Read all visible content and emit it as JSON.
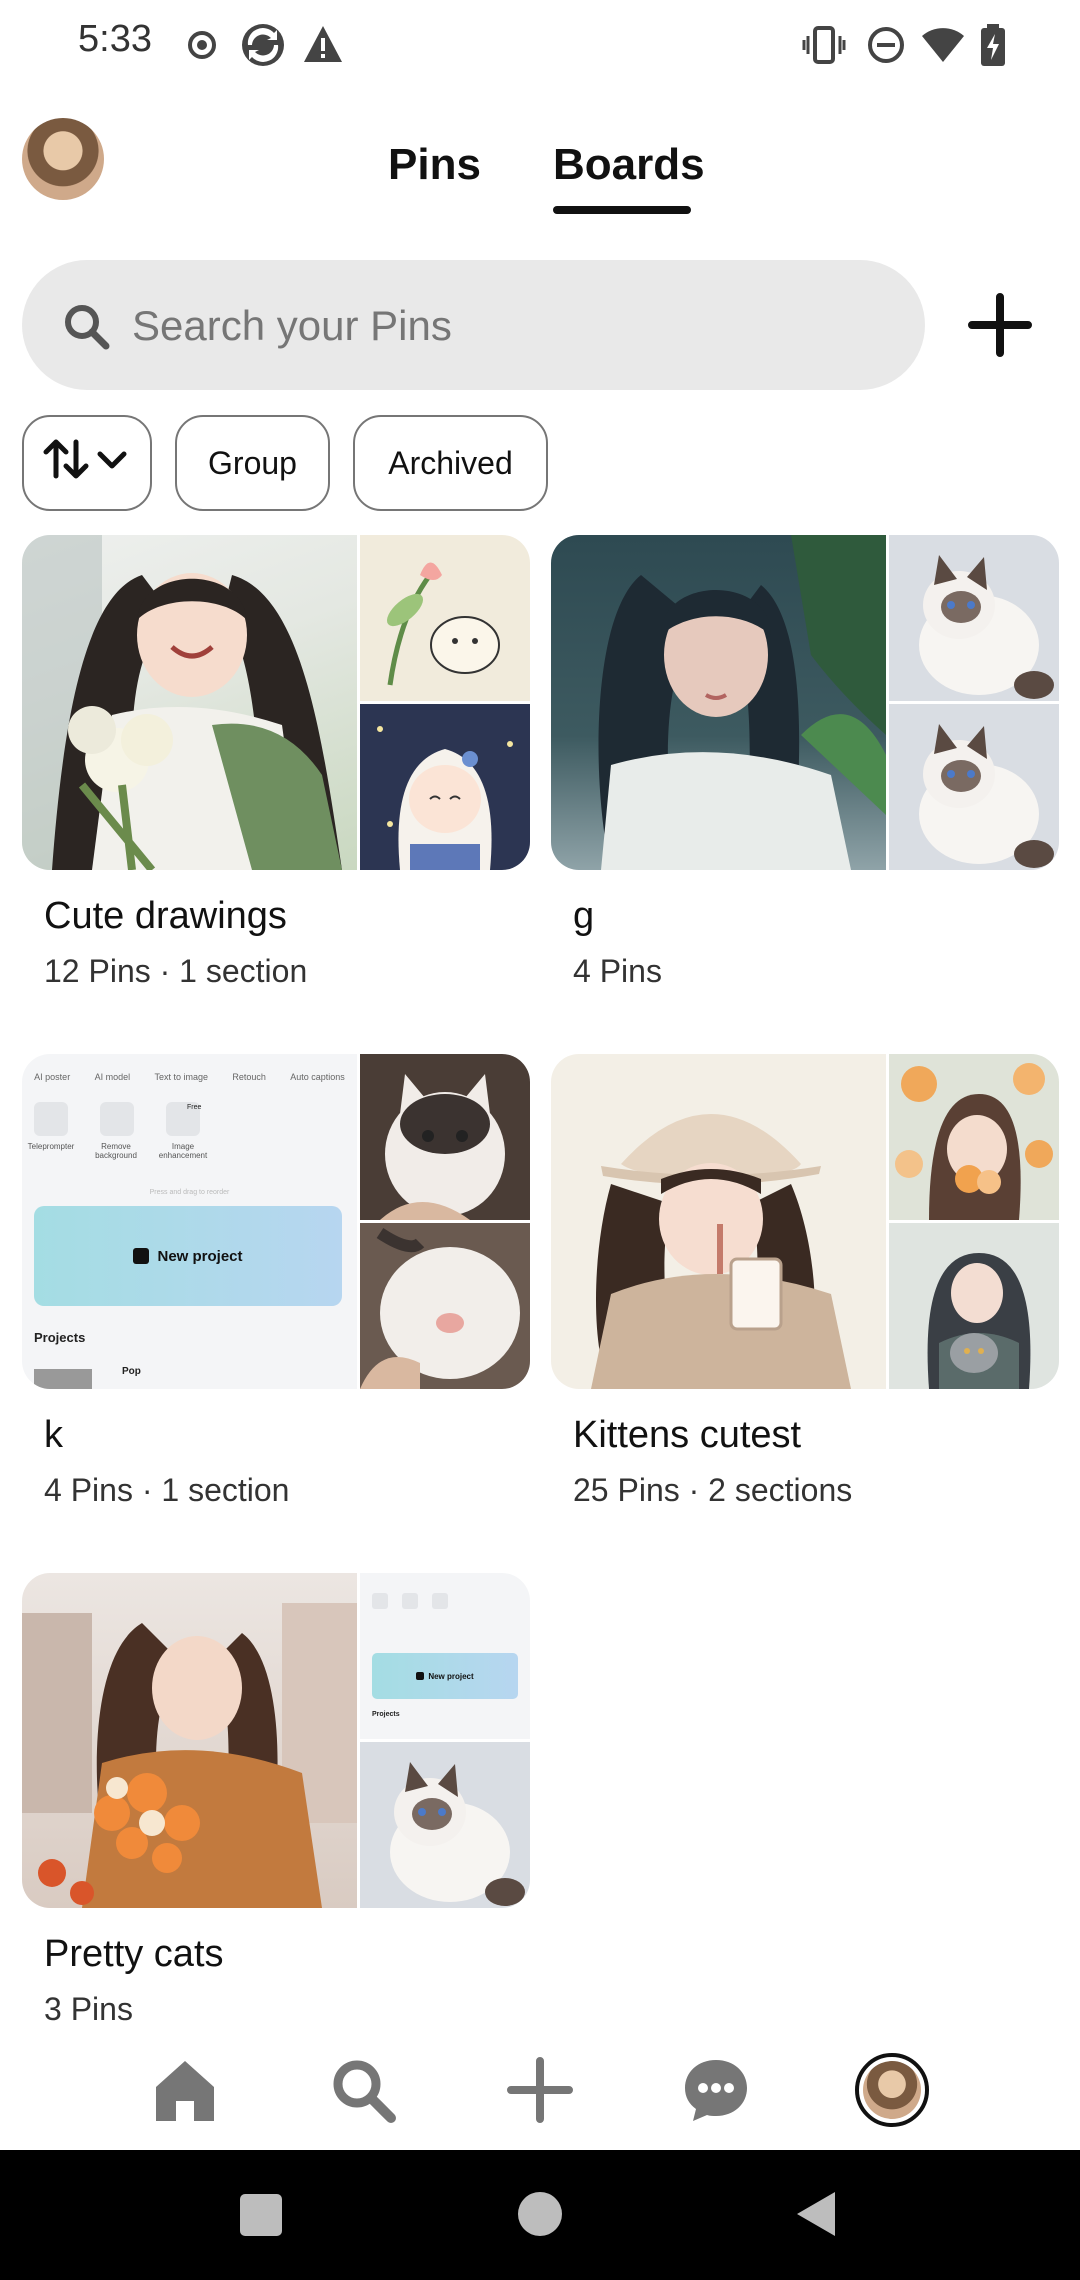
{
  "status_bar": {
    "time": "5:33",
    "left_icons": [
      "record-icon",
      "sync-icon",
      "warning-icon"
    ],
    "right_icons": [
      "vibrate-icon",
      "do-not-disturb-icon",
      "wifi-icon",
      "battery-charging-icon"
    ]
  },
  "header": {
    "tabs": [
      {
        "label": "Pins",
        "selected": false
      },
      {
        "label": "Boards",
        "selected": true
      }
    ]
  },
  "search": {
    "placeholder": "Search your Pins",
    "icon": "search-icon"
  },
  "filters": {
    "sort_icon": "sort-arrows-icon",
    "chips": [
      "Group",
      "Archived"
    ]
  },
  "boards": [
    {
      "title": "Cute drawings",
      "meta": "12 Pins · 1 section"
    },
    {
      "title": "g",
      "meta": "4 Pins"
    },
    {
      "title": "k",
      "meta": "4 Pins · 1 section"
    },
    {
      "title": "Kittens cutest",
      "meta": "25 Pins · 2 sections"
    },
    {
      "title": "Pretty cats",
      "meta": "3 Pins"
    }
  ],
  "board_k_cover": {
    "tabs": [
      "AI poster",
      "AI model",
      "Text to image",
      "Retouch",
      "Auto captions"
    ],
    "tools": [
      "Teleprompter",
      "Remove background",
      "Image enhancement"
    ],
    "badge": "Free",
    "hint": "Press and drag to reorder",
    "cta": "New project",
    "section": "Projects",
    "item": "Pop"
  },
  "bottom_nav": [
    "home-icon",
    "search-icon",
    "create-icon",
    "messages-icon",
    "profile-avatar"
  ],
  "colors": {
    "accent": "#111111",
    "search_bg": "#e9e9e9",
    "chip_border": "#767676"
  }
}
